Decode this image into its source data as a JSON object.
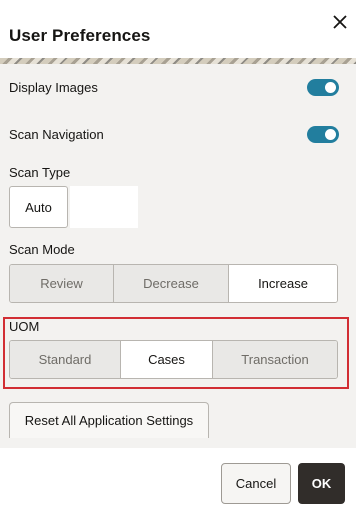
{
  "dialog": {
    "title": "User Preferences"
  },
  "settings": {
    "display_images": {
      "label": "Display Images",
      "enabled": true
    },
    "scan_navigation": {
      "label": "Scan Navigation",
      "enabled": true
    },
    "scan_type": {
      "label": "Scan Type",
      "options": [
        "Auto"
      ],
      "value": ""
    },
    "scan_mode": {
      "label": "Scan Mode",
      "options": [
        "Review",
        "Decrease",
        "Increase"
      ],
      "selected": "Increase"
    },
    "uom": {
      "label": "UOM",
      "options": [
        "Standard",
        "Cases",
        "Transaction"
      ],
      "selected": "Cases"
    },
    "reset_label": "Reset All Application Settings"
  },
  "footer": {
    "cancel_label": "Cancel",
    "ok_label": "OK"
  },
  "colors": {
    "toggle_on": "#227e9e",
    "highlight_border": "#d22e34",
    "primary_button": "#312d2a"
  },
  "icons": {
    "close": "close-icon"
  }
}
